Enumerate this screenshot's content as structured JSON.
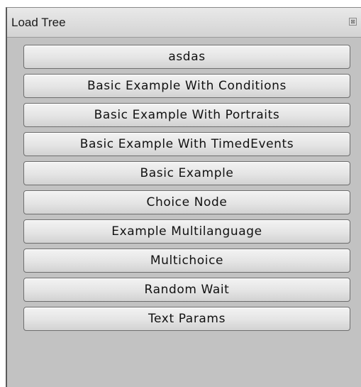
{
  "window": {
    "title": "Load Tree",
    "close_glyph": "⊠"
  },
  "trees": [
    {
      "label": "asdas"
    },
    {
      "label": "Basic Example With Conditions"
    },
    {
      "label": "Basic Example With Portraits"
    },
    {
      "label": "Basic Example With TimedEvents"
    },
    {
      "label": "Basic Example"
    },
    {
      "label": "Choice Node"
    },
    {
      "label": "Example Multilanguage"
    },
    {
      "label": "Multichoice"
    },
    {
      "label": "Random Wait"
    },
    {
      "label": "Text Params"
    }
  ]
}
